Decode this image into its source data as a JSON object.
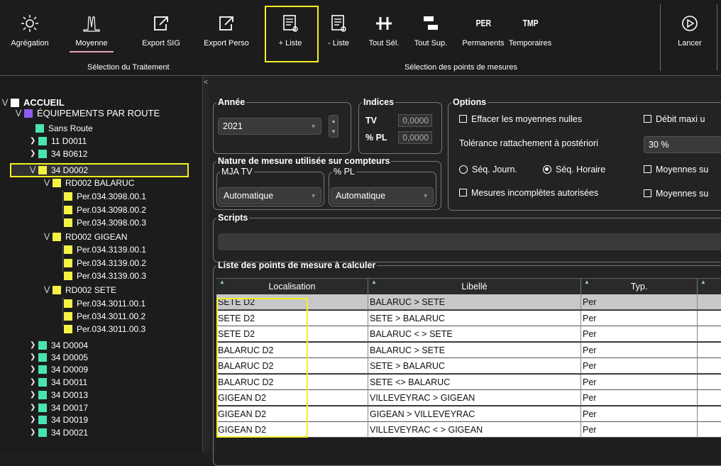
{
  "ribbon": {
    "buttons": [
      {
        "label": "Agrégation",
        "icon": "sun-icon"
      },
      {
        "label": "Moyenne",
        "icon": "moyenne-chart-icon"
      },
      {
        "label": "Export SIG",
        "icon": "export-icon"
      },
      {
        "label": "Export Perso",
        "icon": "export-icon"
      },
      {
        "label": "+ Liste",
        "icon": "list-add-icon"
      },
      {
        "label": "- Liste",
        "icon": "list-remove-icon"
      },
      {
        "label": "Tout Sél.",
        "icon": "select-all-icon"
      },
      {
        "label": "Tout Sup.",
        "icon": "delete-all-icon"
      },
      {
        "label": "Permanents",
        "icon_text": "PER"
      },
      {
        "label": "Temporaires",
        "icon_text": "TMP"
      },
      {
        "label": "Lancer",
        "icon": "play-icon"
      }
    ],
    "group_traitement": "Sélection du Traitement",
    "group_points": "Sélection des points de mesures"
  },
  "tree": [
    {
      "label": "ACCUEIL",
      "color": "#ffffff",
      "expanded": true
    },
    {
      "label": "ÉQUIPEMENTS PAR ROUTE",
      "color": "#8e5bf3",
      "expanded": true
    },
    {
      "label": "Sans Route",
      "color": "#49e3b3"
    },
    {
      "label": "11 D0011",
      "color": "#49e3b3"
    },
    {
      "label": "34 B0612",
      "color": "#49e3b3"
    },
    {
      "label": "34 D0002",
      "color": "#f5f246",
      "expanded": true
    },
    {
      "label": "RD002 BALARUC",
      "color": "#f5f246",
      "expanded": true
    },
    {
      "label": "Per.034.3098.00.1",
      "color": "#f5f246"
    },
    {
      "label": "Per.034.3098.00.2",
      "color": "#f5f246"
    },
    {
      "label": "Per.034.3098.00.3",
      "color": "#f5f246"
    },
    {
      "label": "RD002 GIGEAN",
      "color": "#f5f246",
      "expanded": true
    },
    {
      "label": "Per.034.3139.00.1",
      "color": "#f5f246"
    },
    {
      "label": "Per.034.3139.00.2",
      "color": "#f5f246"
    },
    {
      "label": "Per.034.3139.00.3",
      "color": "#f5f246"
    },
    {
      "label": "RD002 SETE",
      "color": "#f5f246",
      "expanded": true
    },
    {
      "label": "Per.034.3011.00.1",
      "color": "#f5f246"
    },
    {
      "label": "Per.034.3011.00.2",
      "color": "#f5f246"
    },
    {
      "label": "Per.034.3011.00.3",
      "color": "#f5f246"
    },
    {
      "label": "34 D0004",
      "color": "#49e3b3"
    },
    {
      "label": "34 D0005",
      "color": "#49e3b3"
    },
    {
      "label": "34 D0009",
      "color": "#49e3b3"
    },
    {
      "label": "34 D0011",
      "color": "#49e3b3"
    },
    {
      "label": "34 D0013",
      "color": "#49e3b3"
    },
    {
      "label": "34 D0017",
      "color": "#49e3b3"
    },
    {
      "label": "34 D0019",
      "color": "#49e3b3"
    },
    {
      "label": "34 D0021",
      "color": "#49e3b3"
    }
  ],
  "annee": {
    "legend": "Année",
    "value": "2021"
  },
  "indices": {
    "legend": "Indices",
    "tv_label": "TV",
    "tv_value": "0,0000",
    "pl_label": "% PL",
    "pl_value": "0,0000"
  },
  "options": {
    "legend": "Options",
    "effacer": "Effacer les moyennes nulles",
    "debit": "Débit maxi u",
    "tolerance_label": "Tolérance rattachement à postériori",
    "tolerance_value": "30 %",
    "seq_journ": "Séq. Journ.",
    "seq_horaire": "Séq. Horaire",
    "moyennes1": "Moyennes su",
    "incompletes": "Mesures incomplètes autorisées",
    "moyennes2": "Moyennes su"
  },
  "nature": {
    "legend": "Nature de mesure utilisée sur compteurs",
    "mja_legend": "MJA TV",
    "mja_value": "Automatique",
    "pl_legend": "% PL",
    "pl_value": "Automatique"
  },
  "scripts": {
    "legend": "Scripts"
  },
  "liste": {
    "legend": "Liste des points de mesure à calculer",
    "columns": [
      "Localisation",
      "Libellé",
      "Typ."
    ],
    "rows": [
      [
        "SETE D2",
        "BALARUC > SETE",
        "Per"
      ],
      [
        "SETE D2",
        "SETE > BALARUC",
        "Per"
      ],
      [
        "SETE D2",
        "BALARUC < > SETE",
        "Per"
      ],
      [
        "BALARUC D2",
        "BALARUC > SETE",
        "Per"
      ],
      [
        "BALARUC D2",
        "SETE > BALARUC",
        "Per"
      ],
      [
        "BALARUC D2",
        "SETE <> BALARUC",
        "Per"
      ],
      [
        "GIGEAN D2",
        "VILLEVEYRAC > GIGEAN",
        "Per"
      ],
      [
        "GIGEAN D2",
        "GIGEAN > VILLEVEYRAC",
        "Per"
      ],
      [
        "GIGEAN D2",
        "VILLEVEYRAC < > GIGEAN",
        "Per"
      ]
    ]
  },
  "colors": {
    "highlight": "#f3f025",
    "row_bg": "#ffffff",
    "row_selected": "#c8c8c8",
    "accent_underline": "#e7a2b3"
  }
}
